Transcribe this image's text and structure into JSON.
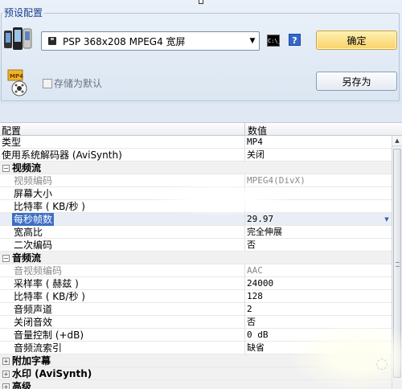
{
  "preset": {
    "group_title": "预设配置",
    "dropdown_value": "PSP 368x208 MPEG4 宽屏",
    "ok_label": "确定",
    "save_as_label": "另存为",
    "save_default_label": "存储为默认",
    "mp4_badge": "MP4",
    "cmd_text": "C:\\_"
  },
  "grid": {
    "header_name": "配置",
    "header_value": "数值",
    "rows": [
      {
        "name": "类型",
        "value": "MP4"
      },
      {
        "name": "使用系统解码器 (AviSynth)",
        "value": "关闭"
      },
      {
        "name": "视频流",
        "value": ""
      },
      {
        "name": "视频编码",
        "value": "MPEG4(DivX)"
      },
      {
        "name": "屏幕大小",
        "value": ""
      },
      {
        "name": "比特率 ( KB/秒 )",
        "value": ""
      },
      {
        "name": "每秒帧数",
        "value": "29.97"
      },
      {
        "name": "宽高比",
        "value": "完全伸展"
      },
      {
        "name": "二次编码",
        "value": "否"
      },
      {
        "name": "音频流",
        "value": ""
      },
      {
        "name": "音视频编码",
        "value": "AAC"
      },
      {
        "name": "采样率 ( 赫兹 )",
        "value": "24000"
      },
      {
        "name": "比特率 ( KB/秒 )",
        "value": "128"
      },
      {
        "name": "音频声道",
        "value": "2"
      },
      {
        "name": "关闭音效",
        "value": "否"
      },
      {
        "name": "音量控制 (+dB)",
        "value": "0 dB"
      },
      {
        "name": "音频流索引",
        "value": "缺省"
      },
      {
        "name": "附加字幕",
        "value": ""
      },
      {
        "name": "水印 (AviSynth)",
        "value": ""
      },
      {
        "name": "高级",
        "value": ""
      }
    ]
  },
  "colors": {
    "accent": "#3d6fc4",
    "ok_button": "#f8d36a",
    "title": "#1c3f8a"
  }
}
